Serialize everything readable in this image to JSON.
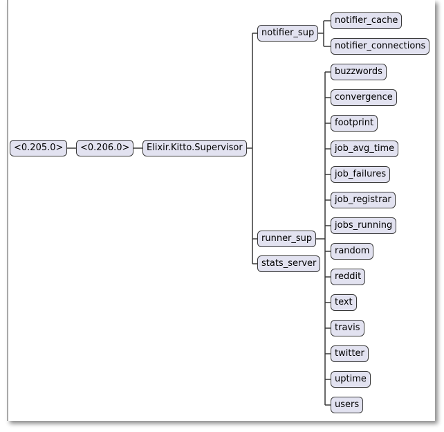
{
  "diagram": {
    "root": "<0.205.0>",
    "level1": "<0.206.0>",
    "supervisor": "Elixir.Kitto.Supervisor",
    "notifier_sup": {
      "label": "notifier_sup",
      "children": [
        "notifier_cache",
        "notifier_connections"
      ]
    },
    "runner_sup": {
      "label": "runner_sup",
      "children": [
        "buzzwords",
        "convergence",
        "footprint",
        "job_avg_time",
        "job_failures",
        "job_registrar",
        "jobs_running",
        "random",
        "reddit",
        "text",
        "travis",
        "twitter",
        "uptime",
        "users"
      ]
    },
    "stats_server": "stats_server"
  },
  "colors": {
    "node_fill": "#e2e2f0",
    "node_border": "#383838",
    "line": "#383838"
  }
}
